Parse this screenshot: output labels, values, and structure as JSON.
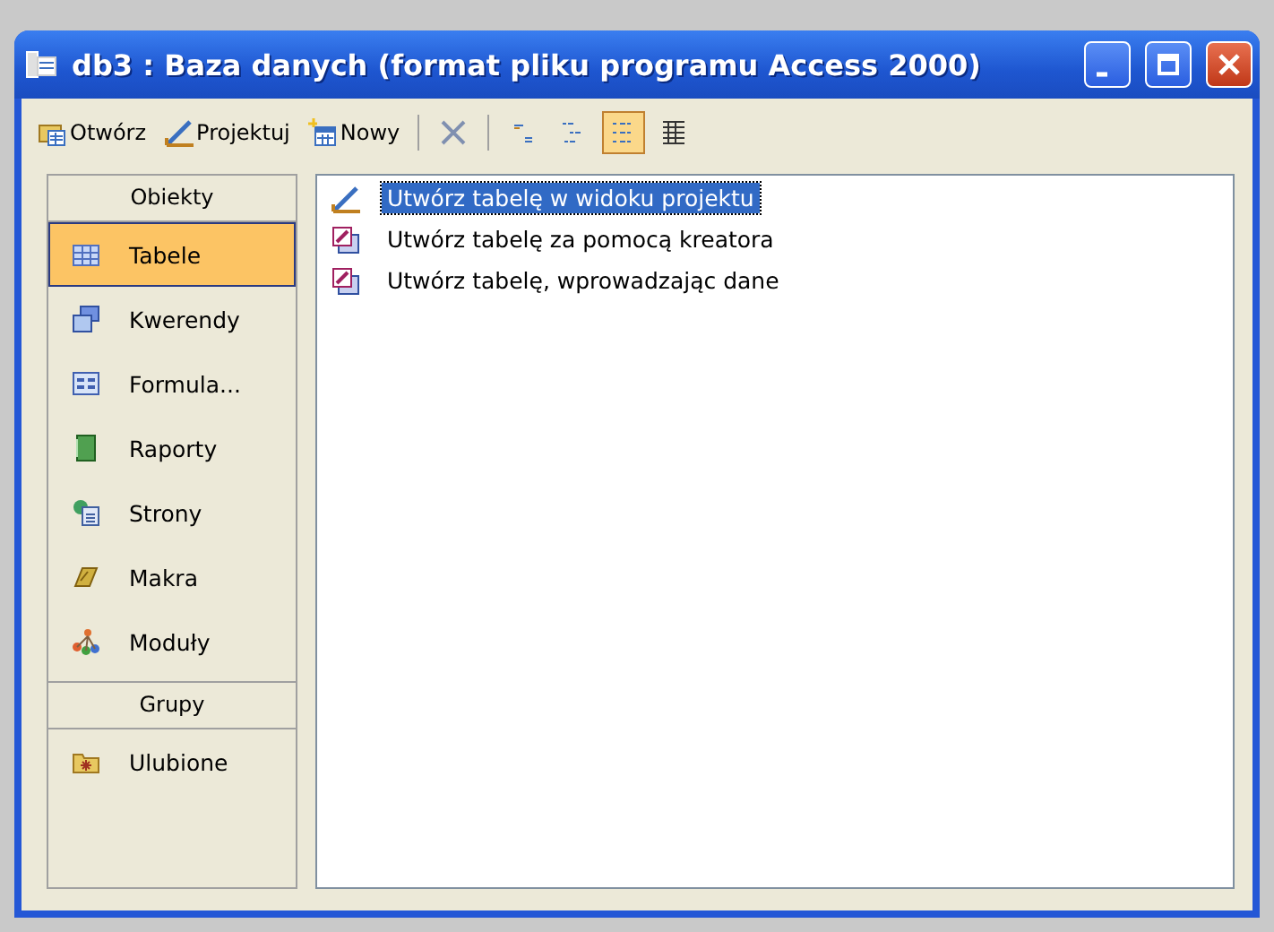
{
  "window": {
    "title": "db3 : Baza danych (format pliku programu Access 2000)"
  },
  "toolbar": [
    {
      "kind": "button",
      "label": "Otwórz"
    },
    {
      "kind": "button",
      "label": "Projektuj"
    },
    {
      "kind": "button",
      "label": "Nowy"
    },
    {
      "kind": "separator"
    },
    {
      "kind": "icon",
      "selected": false
    },
    {
      "kind": "separator"
    },
    {
      "kind": "icon",
      "selected": false
    },
    {
      "kind": "icon",
      "selected": false
    },
    {
      "kind": "icon",
      "selected": true
    },
    {
      "kind": "icon",
      "selected": false
    }
  ],
  "sidebar": {
    "objects_header": "Obiekty",
    "items": [
      {
        "label": "Tabele",
        "kind": "table",
        "selected": true
      },
      {
        "label": "Kwerendy",
        "kind": "query",
        "selected": false
      },
      {
        "label": "Formula...",
        "kind": "form",
        "selected": false
      },
      {
        "label": "Raporty",
        "kind": "report",
        "selected": false
      },
      {
        "label": "Strony",
        "kind": "page",
        "selected": false
      },
      {
        "label": "Makra",
        "kind": "macro",
        "selected": false
      },
      {
        "label": "Moduły",
        "kind": "module",
        "selected": false
      }
    ],
    "groups_header": "Grupy",
    "groups": [
      {
        "label": "Ulubione",
        "kind": "folder",
        "selected": false
      }
    ]
  },
  "list": [
    {
      "label": "Utwórz tabelę w widoku projektu",
      "kind": "design",
      "selected": true
    },
    {
      "label": "Utwórz tabelę za pomocą kreatora",
      "kind": "wizard",
      "selected": false
    },
    {
      "label": "Utwórz tabelę, wprowadzając dane",
      "kind": "wizard",
      "selected": false
    }
  ]
}
